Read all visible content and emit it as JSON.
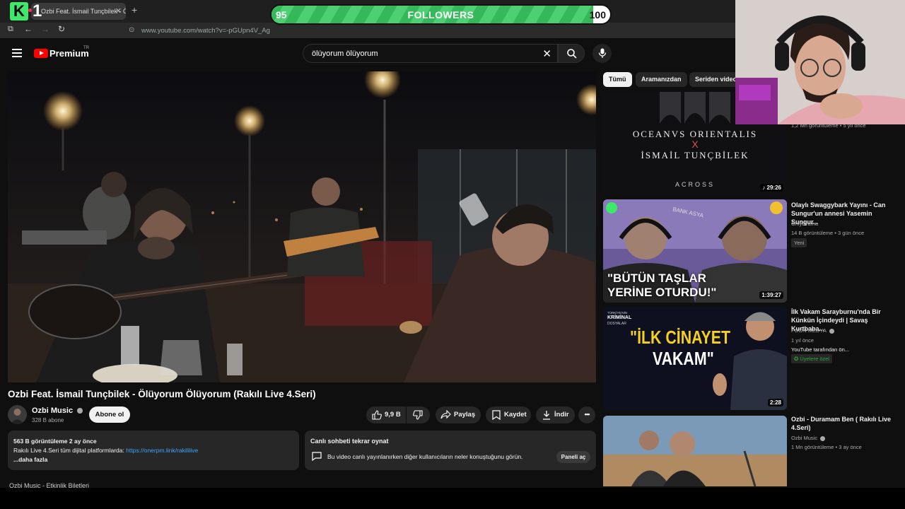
{
  "browser": {
    "tab_title": "Ozbi Feat. İsmail Tunçbilek - Öl",
    "url": "www.youtube.com/watch?v=-pGUpn4V_Ag"
  },
  "overlay": {
    "logo_letter": "K",
    "logo_number": "1",
    "followers_label": "FOLLOWERS",
    "followers_current": "95",
    "followers_goal": "100",
    "followers_progress": 0.95
  },
  "masthead": {
    "logo_text": "Premium",
    "logo_region": "TR",
    "search_value": "ölüyorum ölüyorum"
  },
  "video": {
    "title": "Ozbi Feat. İsmail Tunçbilek - Ölüyorum Ölüyorum (Rakılı Live 4.Seri)",
    "channel_name": "Ozbi Music",
    "subscribers": "328 B abone",
    "subscribe_label": "Abone ol",
    "like_count": "9,9 B",
    "share_label": "Paylaş",
    "save_label": "Kaydet",
    "download_label": "İndir"
  },
  "description": {
    "stats": "563 B görüntüleme  2 ay önce",
    "line1_prefix": "Rakılı Live 4.Seri tüm dijital platformlarda: ",
    "link": "https://onerpm.link/rakililive",
    "more": "...daha fazla"
  },
  "chat": {
    "title": "Canlı sohbeti tekrar oynat",
    "text": "Bu video canlı yayınlanırken diğer kullanıcıların neler konuştuğunu görün.",
    "button": "Paneli aç"
  },
  "below_text": "Ozbi Music - Etkinlik Biletleri",
  "chips": [
    "Tümü",
    "Aramanızdan",
    "Seriden video"
  ],
  "recommendations": [
    {
      "thumb_line1": "OCEANVS ORIENTALIS",
      "thumb_x": "X",
      "thumb_line2": "İSMAİL TUNÇBİLEK",
      "thumb_line3": "ACROSS",
      "duration": "29:26",
      "meta": "1,2 Mn görüntüleme • 5 yıl önce"
    },
    {
      "thumb_text1": "\"BÜTÜN TAŞLAR",
      "thumb_text2": "YERİNE OTURDU!\"",
      "thumb_sign": "BANK ASYA",
      "duration": "1:39:27",
      "title": "Olaylı Swaggybark Yayını - Can Sungur'un annesi Yasemin Sungur...",
      "channel": "OnlyDrama",
      "meta": "14 B görüntüleme • 3 gün önce",
      "badge": "Yeni"
    },
    {
      "thumb_text1": "\"İLK CİNAYET",
      "thumb_text2": "VAKAM\"",
      "thumb_tag1": "TÜRKİYE'NİN",
      "thumb_tag2": "KRİMİNAL",
      "thumb_tag3": "DOSYALAR",
      "duration": "2:28",
      "title": "İlk Vakam Sarayburnu'nda Bir Künkün İçindeydi | Savaş Kurtbaba...",
      "channel": "FOON MEDYA",
      "meta": "1 yıl önce",
      "meta2": "YouTube tarafından ön...",
      "badge": "Üyelere özel"
    },
    {
      "title": "Ozbi - Duramam Ben ( Rakılı Live 4.Seri)",
      "channel": "Ozbi Music",
      "meta": "1 Mn görüntüleme • 3 ay önce"
    }
  ],
  "colors": {
    "bg": "#0f0f0f",
    "accent_red": "#ff0000",
    "link_blue": "#3ea6ff",
    "follower_green": "#35b85a",
    "member_green": "#2ba640"
  }
}
